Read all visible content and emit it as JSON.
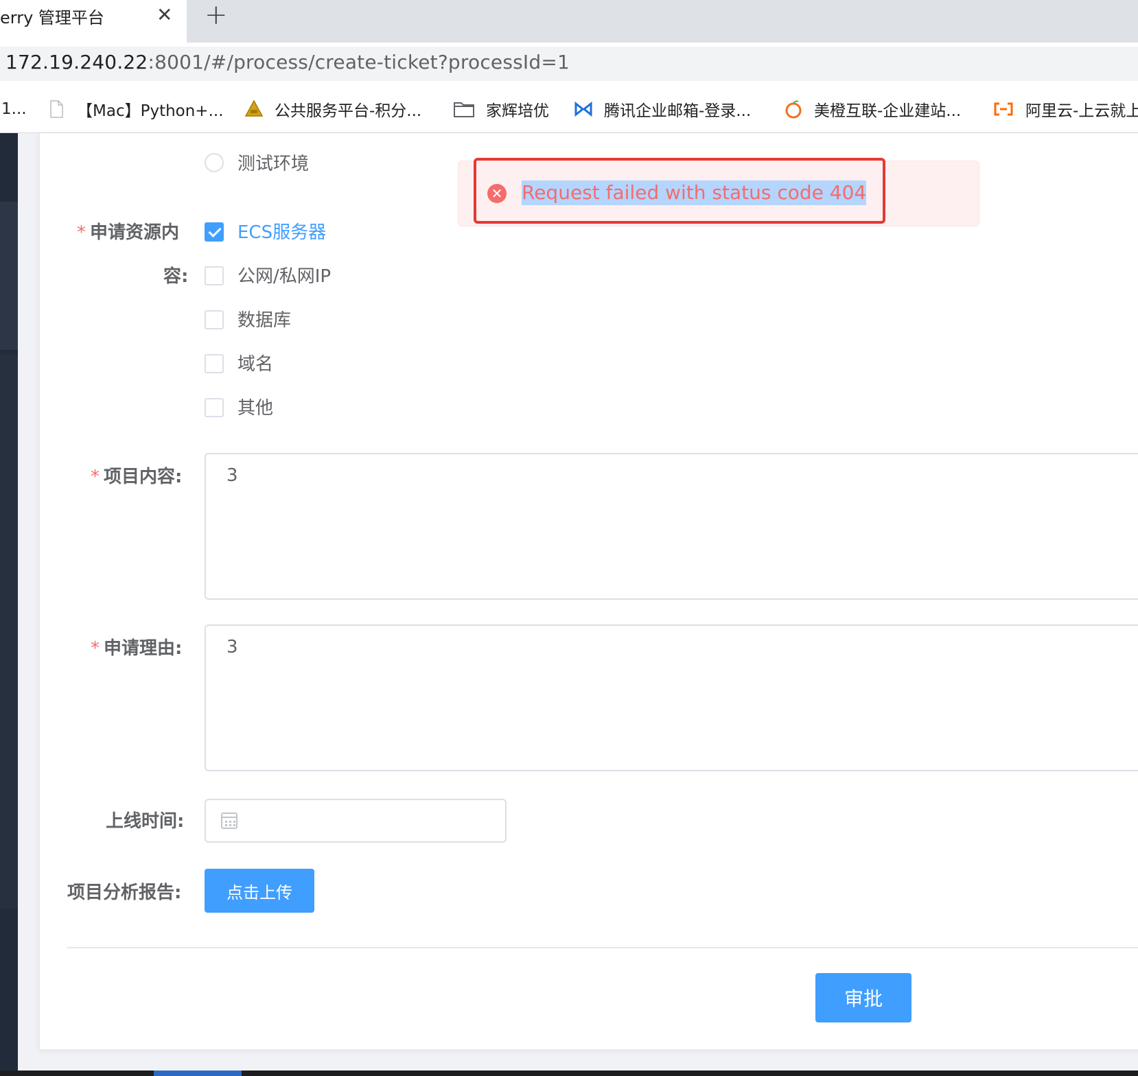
{
  "browser": {
    "tab_title": "erry 管理平台",
    "tab_close": "✕",
    "new_tab": "+",
    "url_host": "172.19.240.22",
    "url_rest": ":8001/#/process/create-ticket?processId=1",
    "bookmarks": [
      {
        "label": "1..."
      },
      {
        "label": "【Mac】Python+..."
      },
      {
        "label": "公共服务平台-积分..."
      },
      {
        "label": "家辉培优"
      },
      {
        "label": "腾讯企业邮箱-登录..."
      },
      {
        "label": "美橙互联-企业建站..."
      },
      {
        "label": "阿里云-上云就上"
      }
    ]
  },
  "form": {
    "env_option": "测试环境",
    "resource_label_line1": "申请资源内",
    "resource_label_line2": "容:",
    "required_mark": "*",
    "resources": [
      {
        "label": "ECS服务器",
        "checked": true
      },
      {
        "label": "公网/私网IP",
        "checked": false
      },
      {
        "label": "数据库",
        "checked": false
      },
      {
        "label": "域名",
        "checked": false
      },
      {
        "label": "其他",
        "checked": false
      }
    ],
    "project_content_label": "项目内容:",
    "project_content_value": "3",
    "reason_label": "申请理由:",
    "reason_value": "3",
    "online_time_label": "上线时间:",
    "report_label": "项目分析报告:",
    "upload_button": "点击上传",
    "approve_button": "审批"
  },
  "message": {
    "text": "Request failed with status code 404",
    "icon": "✕",
    "type": "error",
    "color": "#f56c6c"
  },
  "colors": {
    "primary": "#409eff",
    "danger": "#f56c6c",
    "annotation": "#e53935"
  }
}
